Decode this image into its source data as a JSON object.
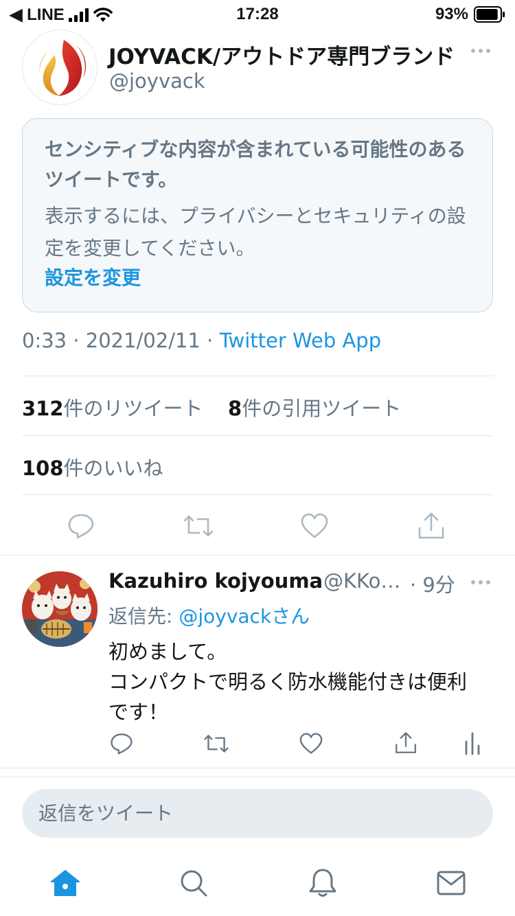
{
  "status_bar": {
    "carrier": "◀ LINE",
    "time": "17:28",
    "battery": "93%",
    "battery_level": 0.93
  },
  "tweet": {
    "author_name": "JOYVACK/アウトドア専門ブランド",
    "author_handle": "@joyvack",
    "sensitive": {
      "title": "センシティブな内容が含まれている可能性のあるツイートです。",
      "description": "表示するには、プライバシーとセキュリティの設定を変更してください。",
      "link": "設定を変更"
    },
    "meta": {
      "time": "0:33",
      "separator": " · ",
      "date": "2021/02/11",
      "source": "Twitter Web App"
    },
    "stats": {
      "retweets_count": "312",
      "retweets_label": "件のリツイート",
      "quotes_count": "8",
      "quotes_label": "件の引用ツイート",
      "likes_count": "108",
      "likes_label": "件のいいね"
    },
    "actions": [
      "reply-icon",
      "retweet-icon",
      "like-icon",
      "share-icon"
    ]
  },
  "reply": {
    "author_name": "Kazuhiro kojyouma",
    "author_handle": "@KKo…",
    "time": "· 9分",
    "reply_to_label": "返信先: ",
    "reply_to_handle": "@joyvackさん",
    "text_lines": [
      "初めまして。",
      "コンパクトで明るく防水機能付きは便利",
      "です！"
    ],
    "actions": [
      "reply-icon",
      "retweet-icon",
      "like-icon",
      "share-icon",
      "analytics-icon"
    ]
  },
  "composer": {
    "placeholder": "返信をツイート"
  },
  "tab_bar": {
    "items": [
      "home-icon",
      "search-icon",
      "notifications-icon",
      "messages-icon"
    ],
    "active": "home-icon"
  },
  "colors": {
    "accent": "#1b95e0",
    "secondary_text": "#657786",
    "icon_gray": "#aab8c2",
    "border": "#e1e8ed"
  }
}
